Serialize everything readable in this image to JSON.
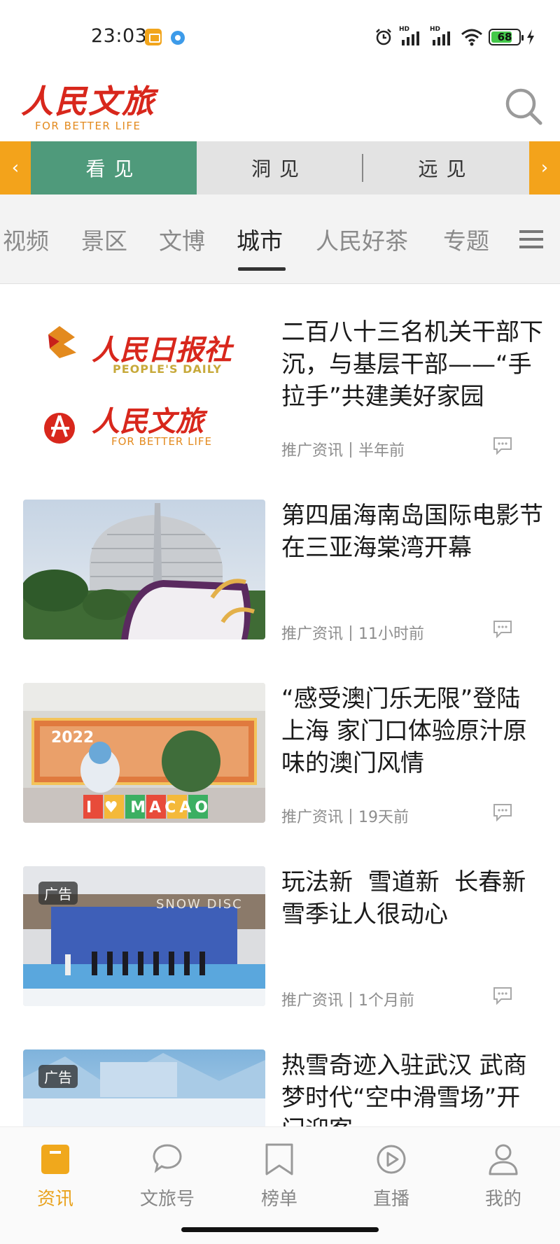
{
  "status_bar": {
    "time": "23:03",
    "signal1_label": "HD",
    "signal2_label": "HD",
    "battery_level": "68"
  },
  "header": {
    "logo_text": "人民文旅",
    "logo_sub": "FOR BETTER LIFE"
  },
  "segments": [
    {
      "label": "看见"
    },
    {
      "label": "洞见"
    },
    {
      "label": "远见"
    }
  ],
  "segment_arrows": {
    "left": "‹",
    "right": "›"
  },
  "categories": [
    {
      "label": "视频"
    },
    {
      "label": "景区"
    },
    {
      "label": "文博"
    },
    {
      "label": "城市"
    },
    {
      "label": "人民好茶"
    },
    {
      "label": "专题"
    }
  ],
  "active_category": "城市",
  "news": [
    {
      "title": "二百八十三名机关干部下沉，与基层干部——“手拉手”共建美好家园",
      "source": "推广资讯",
      "time": "半年前",
      "thumb_logo_top": "人民日报社",
      "thumb_logo_top_sub": "PEOPLE'S DAILY",
      "thumb_logo_bottom": "人民文旅",
      "thumb_logo_bottom_sub": "FOR BETTER LIFE"
    },
    {
      "title": "第四届海南岛国际电影节在三亚海棠湾开幕",
      "source": "推广资讯",
      "time": "11小时前"
    },
    {
      "title": "“感受澳门乐无限”登陆上海 家门口体验原汁原味的澳门风情",
      "source": "推广资讯",
      "time": "19天前",
      "thumb_text": "I ♥ MACAO",
      "thumb_year": "2022"
    },
    {
      "title": "玩法新  雪道新  长春新 雪季让人很动心",
      "source": "推广资讯",
      "time": "1个月前",
      "badge": "广告",
      "thumb_sign": "SNOW DISC"
    },
    {
      "title": "热雪奇迹入驻武汉 武商梦时代“空中滑雪场”开门迎客",
      "badge": "广告"
    }
  ],
  "bottom_nav": [
    {
      "label": "资讯",
      "icon": "news-icon"
    },
    {
      "label": "文旅号",
      "icon": "chat-bubble-icon"
    },
    {
      "label": "榜单",
      "icon": "bookmark-icon"
    },
    {
      "label": "直播",
      "icon": "play-icon"
    },
    {
      "label": "我的",
      "icon": "user-icon"
    }
  ],
  "colors": {
    "accent_orange": "#f3a31b",
    "active_tab_green": "#4f9a7b",
    "brand_red": "#d8271c",
    "nav_active": "#e9a21c"
  }
}
